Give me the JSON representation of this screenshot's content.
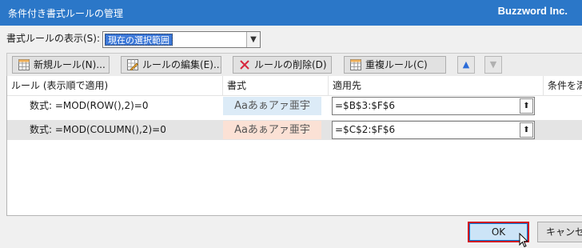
{
  "window": {
    "title": "条件付き書式ルールの管理",
    "brand": "Buzzword Inc."
  },
  "show_rules": {
    "label": "書式ルールの表示(S):",
    "value": "現在の選択範囲"
  },
  "toolbar": {
    "new_rule": "新規ルール(N)...",
    "edit_rule": "ルールの編集(E)...",
    "delete_rule": "ルールの削除(D)",
    "duplicate_rule": "重複ルール(C)",
    "move_up": "▲",
    "move_down": "▼"
  },
  "columns": [
    "ルール (表示順で適用)",
    "書式",
    "適用先",
    "条件を満"
  ],
  "rules": [
    {
      "rule": "数式: =MOD(ROW(),2)=0",
      "preview": "Aaあぁアァ亜宇",
      "preview_bg": "#dcebf7",
      "applies_to": "=$B$3:$F$6"
    },
    {
      "rule": "数式: =MOD(COLUMN(),2)=0",
      "preview": "Aaあぁアァ亜宇",
      "preview_bg": "#fbe1d5",
      "applies_to": "=$C$2:$F$6"
    }
  ],
  "buttons": {
    "ok": "OK",
    "cancel": "キャンセル"
  },
  "colors": {
    "titlebar": "#2b77c8",
    "highlight_border": "#d01020"
  }
}
